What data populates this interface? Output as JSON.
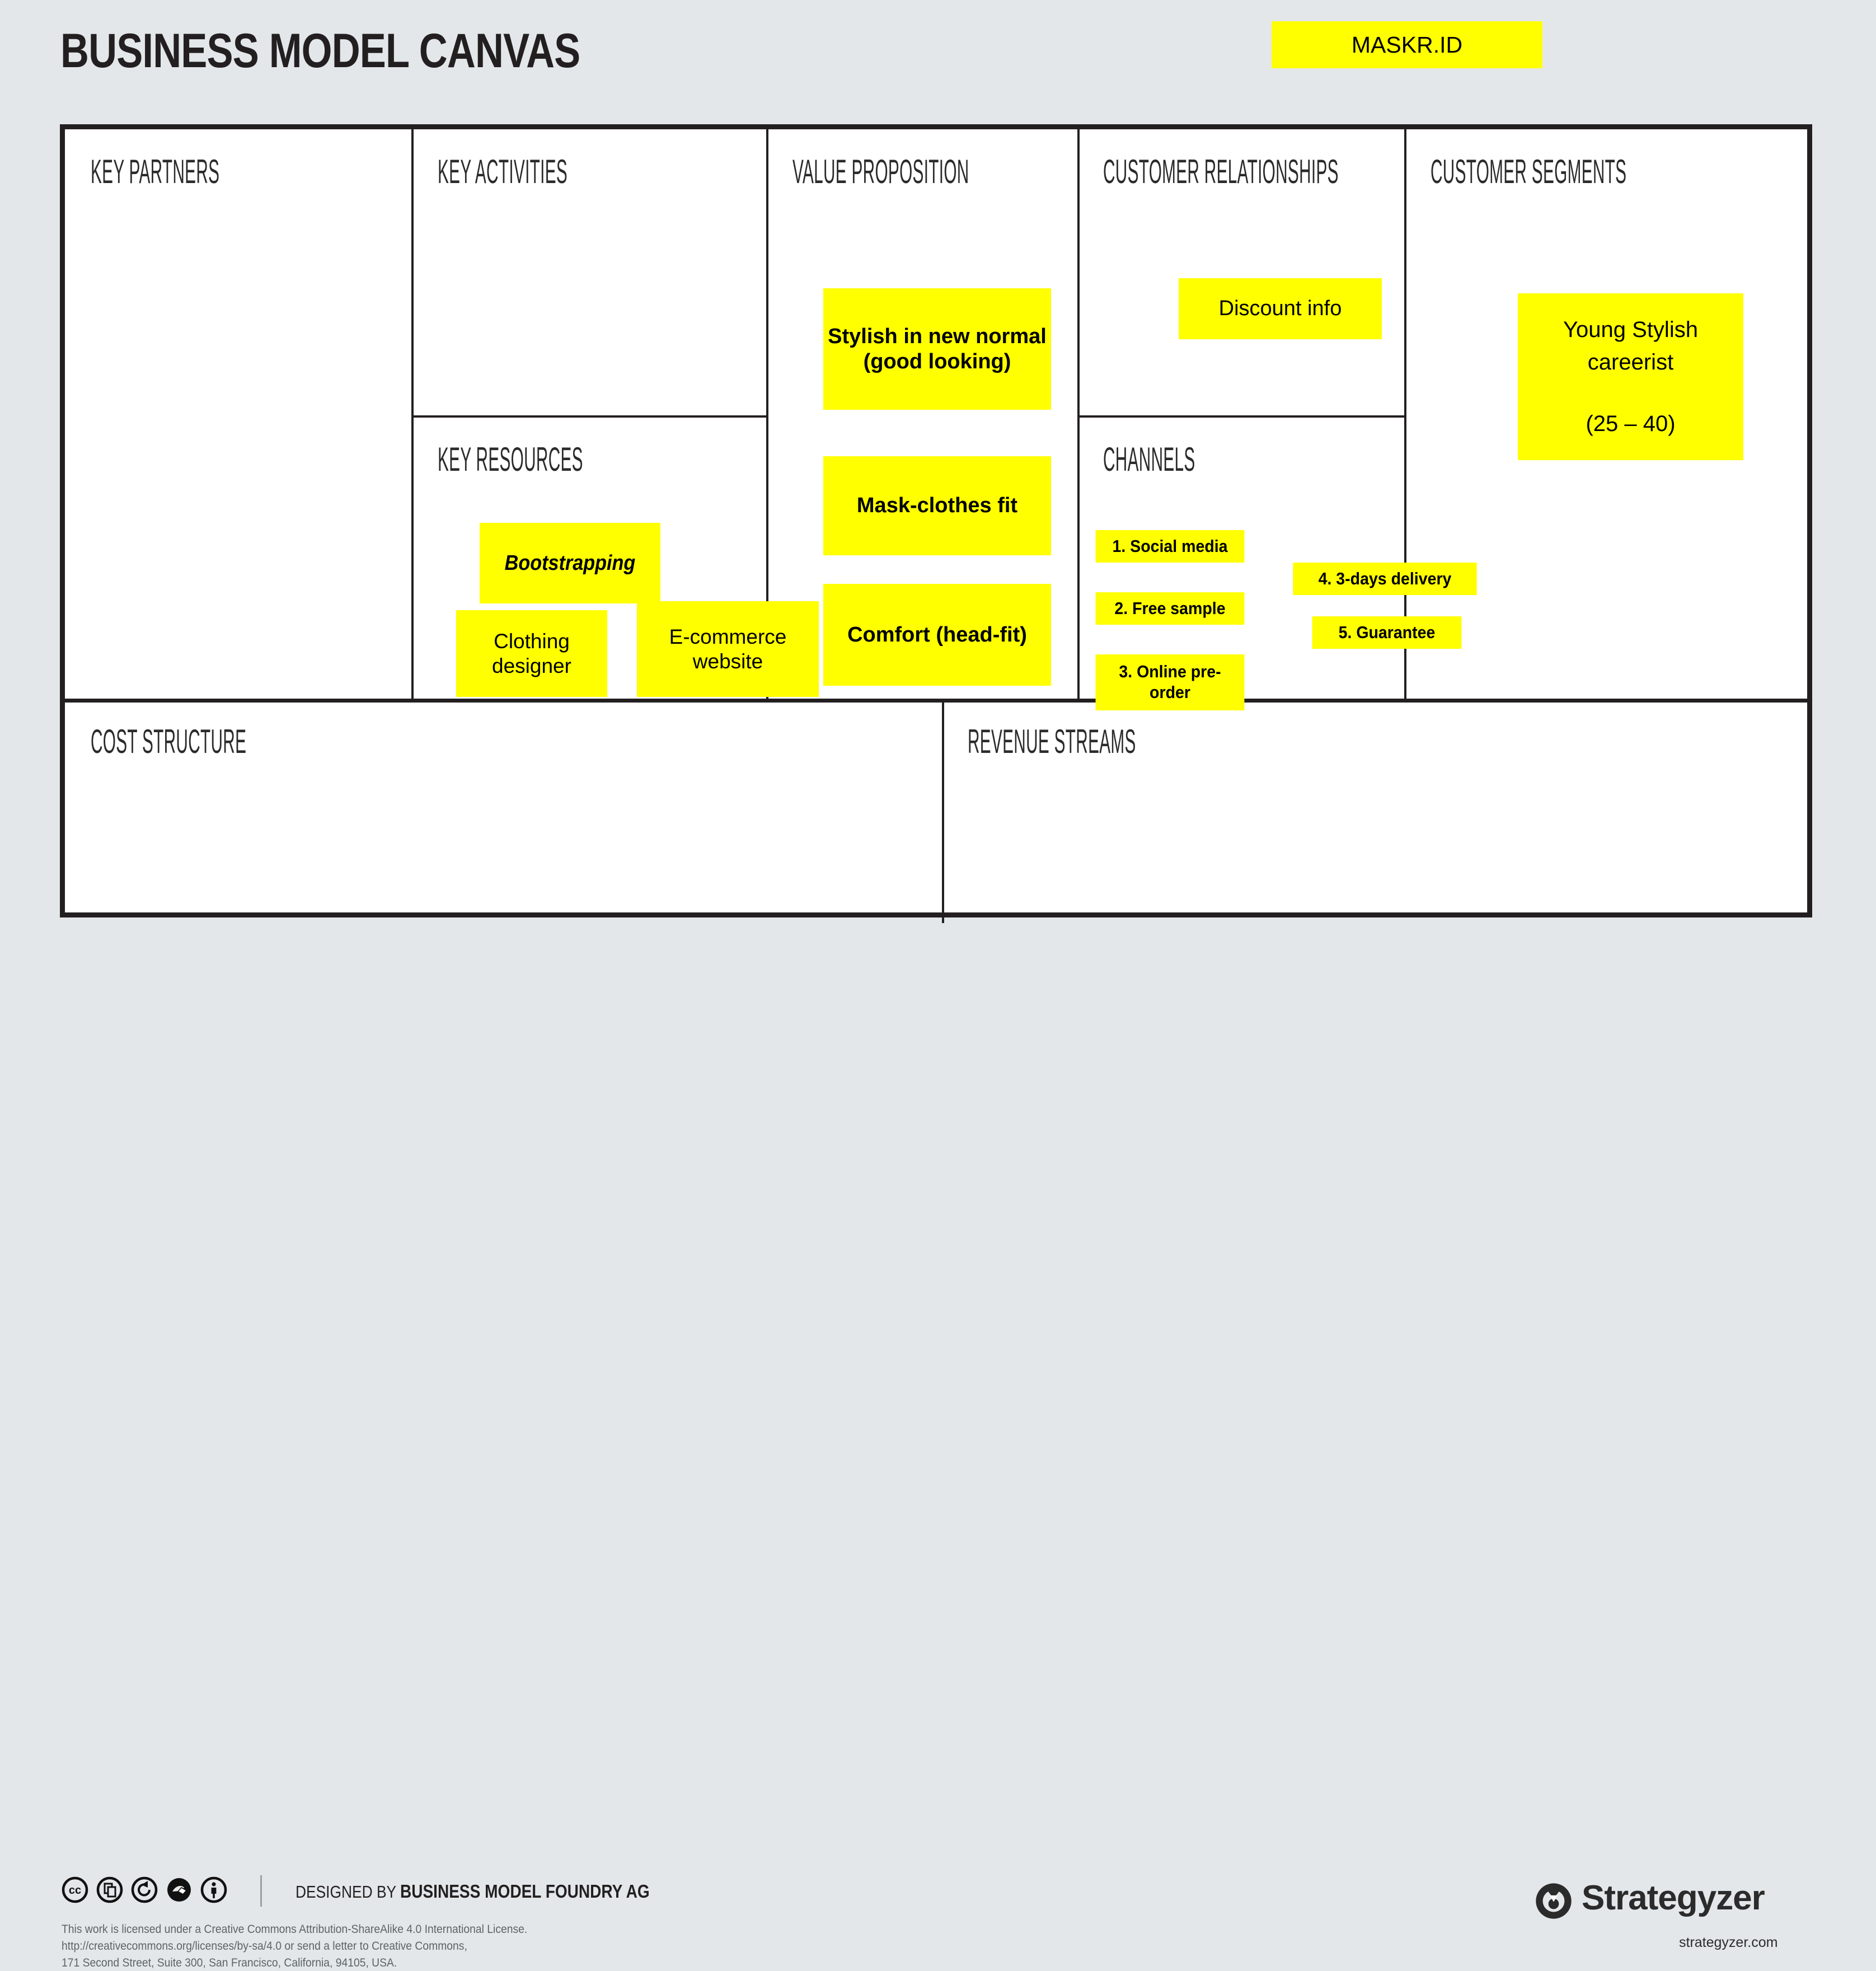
{
  "header": {
    "title": "BUSINESS MODEL CANVAS",
    "company_badge": "MASKR.ID",
    "badge_color": "#FFFF00"
  },
  "blocks": {
    "key_partners": {
      "label": "KEY PARTNERS",
      "notes": []
    },
    "key_activities": {
      "label": "KEY ACTIVITIES",
      "notes": []
    },
    "key_resources": {
      "label": "KEY RESOURCES",
      "notes": [
        {
          "text": "Bootstrapping",
          "style": "bold-italic"
        },
        {
          "text": "Clothing designer",
          "style": "regular"
        },
        {
          "text": "E-commerce website",
          "style": "regular"
        }
      ]
    },
    "value_proposition": {
      "label": "VALUE PROPOSITION",
      "notes": [
        {
          "text": "Stylish in new normal (good looking)"
        },
        {
          "text": "Mask-clothes fit"
        },
        {
          "text": "Comfort (head-fit)"
        }
      ]
    },
    "customer_relationships": {
      "label": "CUSTOMER RELATIONSHIPS",
      "notes": [
        {
          "text": "Discount info"
        }
      ]
    },
    "channels": {
      "label": "CHANNELS",
      "notes": [
        {
          "text": "1. Social media"
        },
        {
          "text": "2. Free sample"
        },
        {
          "text": "3. Online pre-order"
        },
        {
          "text": "4. 3-days delivery"
        },
        {
          "text": "5. Guarantee"
        }
      ]
    },
    "customer_segments": {
      "label": "CUSTOMER SEGMENTS",
      "notes": [
        {
          "line1": "Young Stylish careerist",
          "line2": "(25 – 40)"
        }
      ]
    },
    "cost_structure": {
      "label": "COST STRUCTURE",
      "notes": []
    },
    "revenue_streams": {
      "label": "REVENUE STREAMS",
      "notes": []
    }
  },
  "footer": {
    "designed_by_prefix": "DESIGNED BY ",
    "designed_by_name": "BUSINESS MODEL FOUNDRY AG",
    "license_line1": "This work is licensed under a Creative Commons Attribution-ShareAlike 4.0 International License.",
    "license_line2": "http://creativecommons.org/licenses/by-sa/4.0 or send a letter to Creative Commons,",
    "license_line3": "171 Second Street, Suite 300, San Francisco, California, 94105, USA.",
    "brand_name": "Strategyzer",
    "brand_url": "strategyzer.com",
    "cc_icons": [
      "creative-commons-icon",
      "share-icon",
      "share-alike-icon",
      "noncommercial-remix-icon",
      "attribution-person-icon"
    ]
  }
}
